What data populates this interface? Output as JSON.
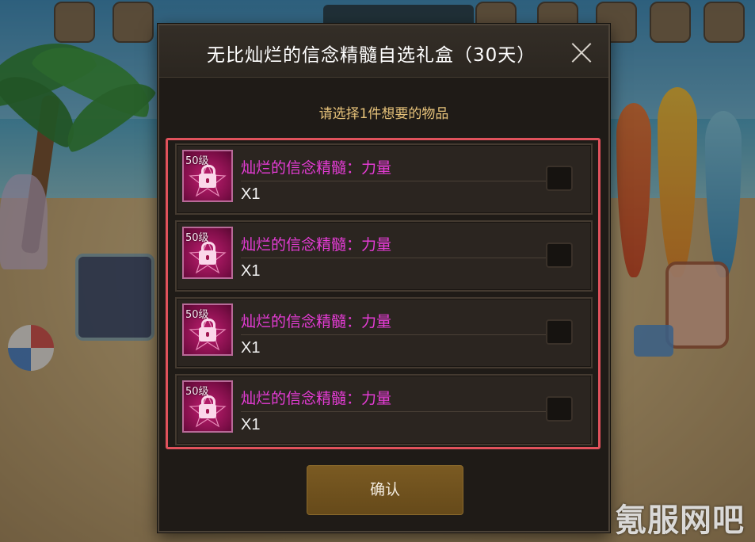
{
  "dialog": {
    "title": "无比灿烂的信念精髓自选礼盒（30天）",
    "close_icon": "close-icon",
    "subtitle": "请选择1件想要的物品",
    "confirm_label": "确认"
  },
  "items": [
    {
      "level": "50级",
      "name": "灿烂的信念精髓：力量",
      "quantity": "X1",
      "checked": false,
      "icon": "lock-icon"
    },
    {
      "level": "50级",
      "name": "灿烂的信念精髓：力量",
      "quantity": "X1",
      "checked": false,
      "icon": "lock-icon"
    },
    {
      "level": "50级",
      "name": "灿烂的信念精髓：力量",
      "quantity": "X1",
      "checked": false,
      "icon": "lock-icon"
    },
    {
      "level": "50级",
      "name": "灿烂的信念精髓：力量",
      "quantity": "X1",
      "checked": false,
      "icon": "lock-icon"
    }
  ],
  "watermark": "氪服网吧",
  "colors": {
    "item_name": "#e63cd6",
    "highlight_frame": "#e0525c",
    "subtitle": "#e6c27a",
    "confirm_button": "#6f5020"
  }
}
